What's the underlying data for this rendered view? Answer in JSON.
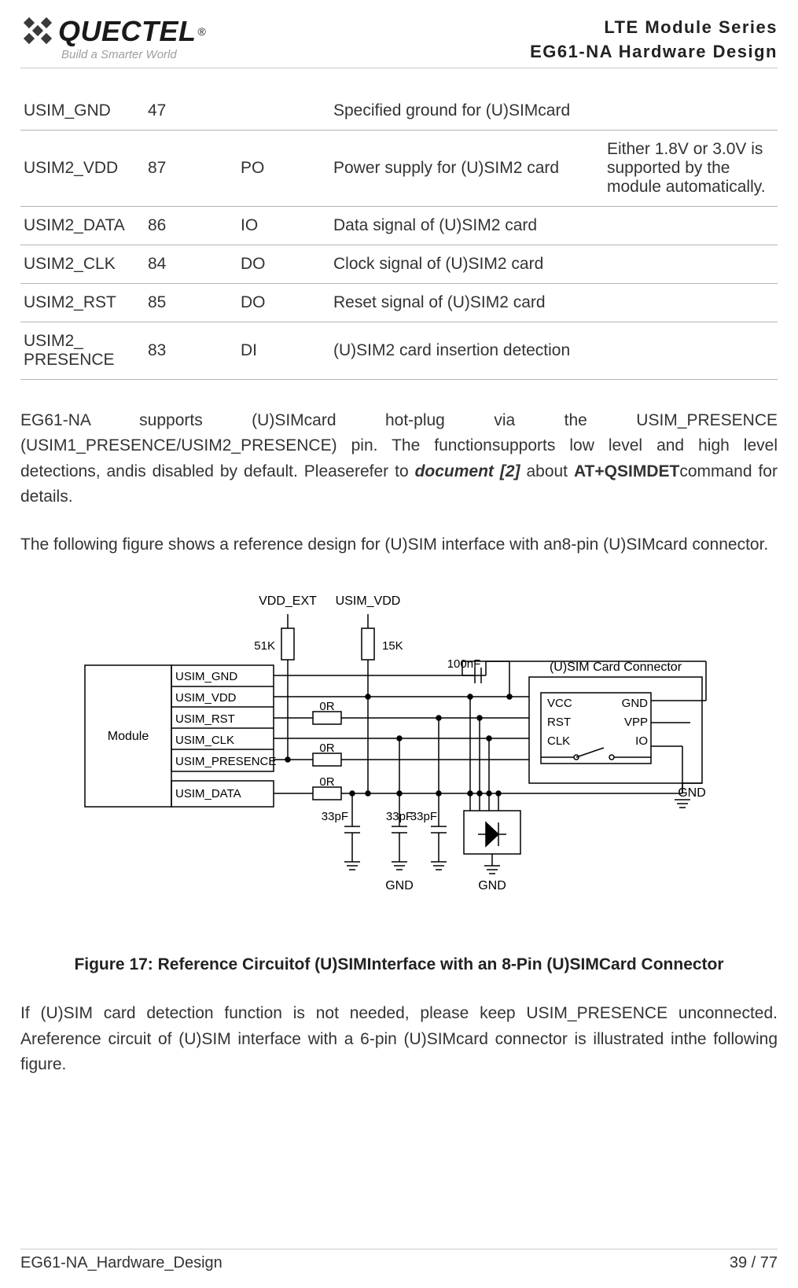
{
  "header": {
    "brand": "QUECTEL",
    "reg": "®",
    "tagline": "Build a Smarter World",
    "line1": "LTE Module Series",
    "line2": "EG61-NA Hardware Design"
  },
  "table": {
    "rows": [
      {
        "name": "USIM_GND",
        "pin": "47",
        "io": "",
        "desc": "Specified ground for (U)SIMcard",
        "comment": ""
      },
      {
        "name": "USIM2_VDD",
        "pin": "87",
        "io": "PO",
        "desc": "Power supply for (U)SIM2 card",
        "comment": "Either 1.8V or 3.0V is supported by the module automatically."
      },
      {
        "name": "USIM2_DATA",
        "pin": "86",
        "io": "IO",
        "desc": "Data signal of (U)SIM2 card",
        "comment": ""
      },
      {
        "name": "USIM2_CLK",
        "pin": "84",
        "io": "DO",
        "desc": "Clock signal of (U)SIM2 card",
        "comment": ""
      },
      {
        "name": "USIM2_RST",
        "pin": "85",
        "io": "DO",
        "desc": "Reset signal of (U)SIM2 card",
        "comment": ""
      },
      {
        "name": "USIM2_ PRESENCE",
        "pin": "83",
        "io": "DI",
        "desc": "(U)SIM2 card insertion detection",
        "comment": ""
      }
    ]
  },
  "para1_a": "EG61-NA supports (U)SIMcard hot-plug via the USIM_PRESENCE (USIM1_PRESENCE/USIM2_PRESENCE) pin. The functionsupports low level and high level detections, andis disabled by default. Pleaserefer to ",
  "para1_doc": "document [2]",
  "para1_b": " about ",
  "para1_cmd": "AT+QSIMDET",
  "para1_c": "command for details.",
  "para2": "The following figure shows a reference design for (U)SIM interface with an8-pin (U)SIMcard connector.",
  "diagram": {
    "module": "Module",
    "signals": {
      "gnd": "USIM_GND",
      "vdd": "USIM_VDD",
      "rst": "USIM_RST",
      "clk": "USIM_CLK",
      "presence": "USIM_PRESENCE",
      "data": "USIM_DATA"
    },
    "top": {
      "vdd_ext": "VDD_EXT",
      "usim_vdd": "USIM_VDD"
    },
    "series": {
      "r0_1": "0R",
      "r0_2": "0R",
      "r0_3": "0R"
    },
    "pullups": {
      "r51k": "51K",
      "r15k": "15K"
    },
    "caps": {
      "c1": "33pF",
      "c2": "33pF",
      "c3": "33pF",
      "c100n": "100nF"
    },
    "gnd_labels": {
      "g1": "GND",
      "g2": "GND",
      "g3": "GND"
    },
    "connector": {
      "title": "(U)SIM Card Connector",
      "vcc": "VCC",
      "rst": "RST",
      "clk": "CLK",
      "gnd": "GND",
      "vpp": "VPP",
      "io": "IO"
    }
  },
  "figure_caption": "Figure 17: Reference Circuitof (U)SIMInterface with an 8-Pin (U)SIMCard Connector",
  "para3": "If (U)SIM card detection function is not needed, please keep USIM_PRESENCE unconnected. Areference circuit of (U)SIM interface with a 6-pin (U)SIMcard connector is illustrated inthe following figure.",
  "footer": {
    "left": "EG61-NA_Hardware_Design",
    "right": "39 / 77"
  }
}
